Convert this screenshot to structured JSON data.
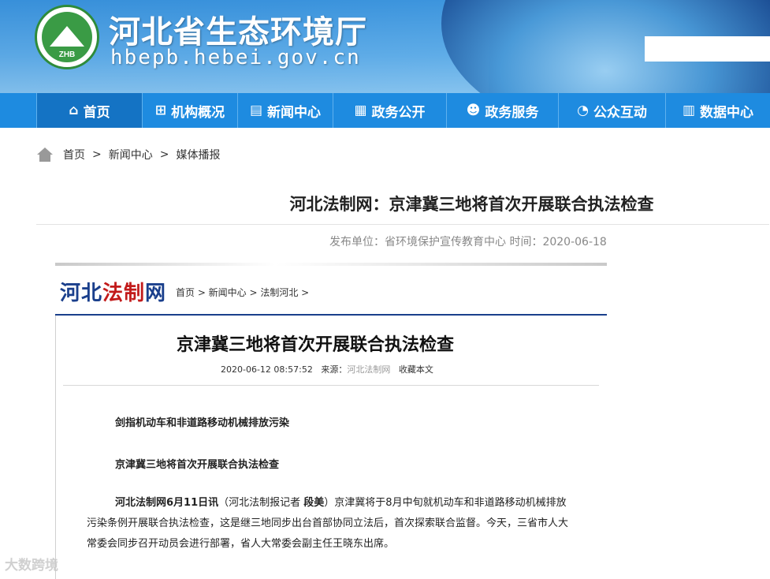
{
  "header": {
    "site_title": "河北省生态环境厅",
    "site_url": "hbepb.hebei.gov.cn",
    "logo_text": "ZHB"
  },
  "nav": {
    "items": [
      {
        "label": "首页",
        "icon": "home-icon"
      },
      {
        "label": "机构概况",
        "icon": "org-chart-icon"
      },
      {
        "label": "新闻中心",
        "icon": "news-icon"
      },
      {
        "label": "政务公开",
        "icon": "document-icon"
      },
      {
        "label": "政务服务",
        "icon": "people-icon"
      },
      {
        "label": "公众互动",
        "icon": "chat-icon"
      },
      {
        "label": "数据中心",
        "icon": "book-icon"
      }
    ]
  },
  "breadcrumb": {
    "items": [
      "首页",
      "新闻中心",
      "媒体播报"
    ],
    "separator": ">"
  },
  "article": {
    "title": "河北法制网：京津冀三地将首次开展联合执法检查",
    "meta": "发布单位：省环境保护宣传教育中心 时间：2020-06-18"
  },
  "embed": {
    "logo_part1": "河北",
    "logo_part2": "法制",
    "logo_part3": "网",
    "crumb": "首页 > 新闻中心 > 法制河北 >",
    "title": "京津冀三地将首次开展联合执法检查",
    "meta_datetime": "2020-06-12 08:57:52",
    "meta_source_label": "来源：",
    "meta_source": "河北法制网",
    "meta_collect": "收藏本文",
    "heading1": "剑指机动车和非道路移动机械排放污染",
    "heading2": "京津冀三地将首次开展联合执法检查",
    "para_lead": "河北法制网6月11日讯",
    "para_paren_open": "（河北法制报记者 ",
    "para_reporter": "段美",
    "para_rest": "）京津冀将于8月中旬就机动车和非道路移动机械排放污染条例开展联合执法检查，这是继三地同步出台首部协同立法后，首次探索联合监督。今天，三省市人大常委会同步召开动员会进行部署，省人大常委会副主任王晓东出席。"
  },
  "watermark": "大数跨境"
}
